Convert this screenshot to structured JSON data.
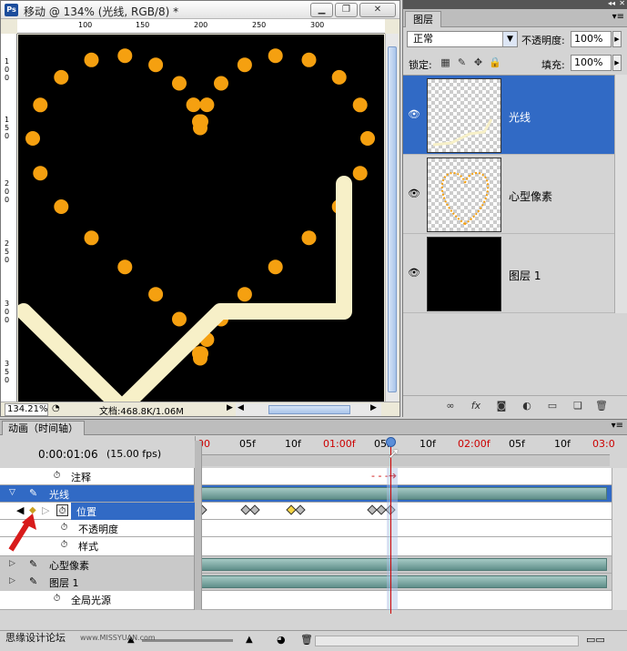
{
  "document": {
    "title": "移动 @ 134% (光线, RGB/8) *",
    "app_icon": "Ps",
    "ruler_top_labels": [
      "100",
      "150",
      "200",
      "250",
      "300"
    ],
    "ruler_left_labels": [
      "1\n0\n0",
      "1\n5\n0",
      "2\n0\n0",
      "2\n5\n0",
      "3\n0\n0",
      "3\n5\n0"
    ],
    "zoom": "134.21%",
    "doc_size": "文档:468.8K/1.06M"
  },
  "layers_panel": {
    "tab": "图层",
    "blend_mode": "正常",
    "opacity_label": "不透明度:",
    "opacity_value": "100%",
    "lock_label": "锁定:",
    "fill_label": "填充:",
    "fill_value": "100%",
    "layers": [
      {
        "name": "光线",
        "selected": true,
        "visible": true
      },
      {
        "name": "心型像素",
        "selected": false,
        "visible": true
      },
      {
        "name": "图层 1",
        "selected": false,
        "visible": true
      }
    ]
  },
  "animation": {
    "tab": "动画（时间轴）",
    "timecode": "0:00:01:06",
    "fps": "(15.00 fps)",
    "ruler_labels": [
      "00",
      "05f",
      "10f",
      "01:00f",
      "05f",
      "10f",
      "02:00f",
      "05f",
      "10f",
      "03:0"
    ],
    "rows": [
      {
        "label": "注释",
        "kind": "property"
      },
      {
        "label": "光线",
        "kind": "layer",
        "selected": true
      },
      {
        "label": "位置",
        "kind": "keyed",
        "selected": true
      },
      {
        "label": "不透明度",
        "kind": "property"
      },
      {
        "label": "样式",
        "kind": "property"
      },
      {
        "label": "心型像素",
        "kind": "layer"
      },
      {
        "label": "图层 1",
        "kind": "layer"
      },
      {
        "label": "全局光源",
        "kind": "property"
      }
    ]
  },
  "watermark": {
    "text": "思缘设计论坛",
    "url": "www.MISSYUAN.com"
  },
  "colors": {
    "selection_blue": "#316ac5",
    "track_teal": "#5f8f8a",
    "playhead_red": "#cc0000",
    "dot_orange": "#f5a010",
    "light_beam": "#f7f0c8"
  }
}
